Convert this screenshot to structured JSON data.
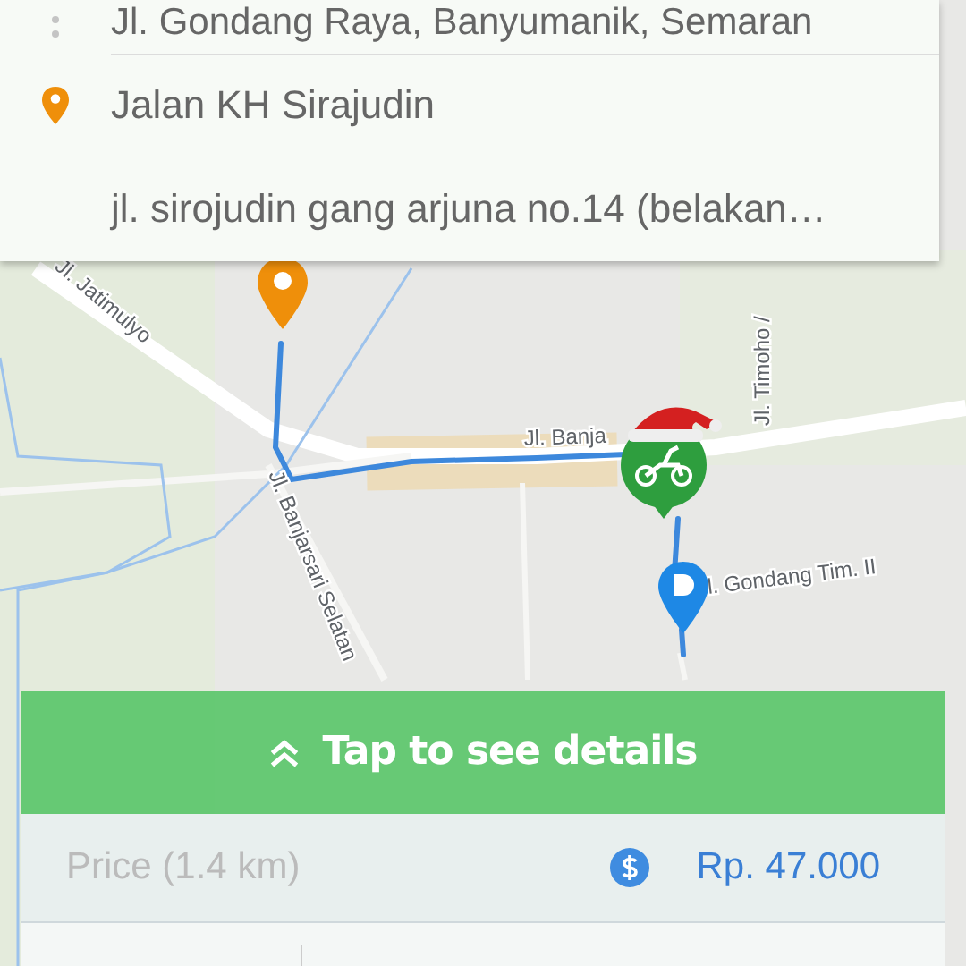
{
  "addresses": [
    {
      "kind": "waypoint",
      "text": "Jl. Gondang Raya, Banyumanik, Semaran"
    },
    {
      "kind": "destination",
      "text": "Jalan KH Sirajudin"
    },
    {
      "kind": "note",
      "text": "jl. sirojudin gang arjuna no.14 (belakan…"
    }
  ],
  "map": {
    "road_labels": [
      "Jl. Jatimulyo",
      "Jl. Banjarsari Selatan",
      "Jl. Banja",
      "Jl. Timoho /",
      "l. Gondang Tim. II"
    ]
  },
  "details_bar": {
    "label": "Tap to see details"
  },
  "price": {
    "label": "Price (1.4 km)",
    "value": "Rp. 47.000"
  }
}
